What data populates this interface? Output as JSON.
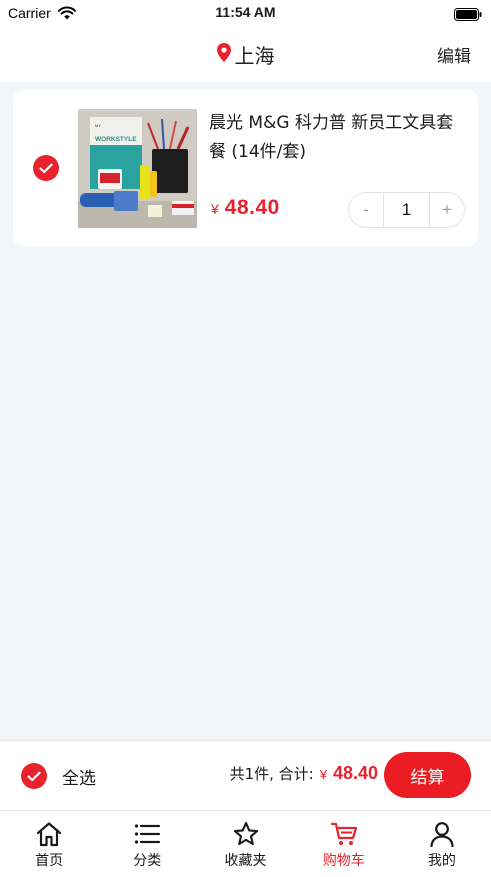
{
  "status_bar": {
    "carrier": "Carrier",
    "time": "11:54 AM",
    "wifi_icon": "wifi-icon",
    "battery_icon": "battery-icon"
  },
  "nav": {
    "location_icon": "location-pin-icon",
    "city": "上海",
    "edit_label": "编辑"
  },
  "cart": {
    "items": [
      {
        "selected": true,
        "title": "晨光 M&G 科力普 新员工文具套餐 (14件/套)",
        "currency": "¥",
        "price": "48.40",
        "quantity": "1",
        "decrement_label": "-",
        "increment_label": "+",
        "thumb_text": "WORKSTYLE"
      }
    ]
  },
  "summary": {
    "select_all_label": "全选",
    "total_label": "共1件, 合计:",
    "currency": "¥",
    "total_value": "48.40",
    "checkout_label": "结算"
  },
  "tabs": [
    {
      "label": "首页",
      "icon": "home-icon",
      "active": false
    },
    {
      "label": "分类",
      "icon": "list-icon",
      "active": false
    },
    {
      "label": "收藏夹",
      "icon": "star-icon",
      "active": false
    },
    {
      "label": "购物车",
      "icon": "cart-icon",
      "active": true
    },
    {
      "label": "我的",
      "icon": "user-icon",
      "active": false
    }
  ],
  "colors": {
    "accent": "#e8232d",
    "background": "#f3f6f9"
  }
}
